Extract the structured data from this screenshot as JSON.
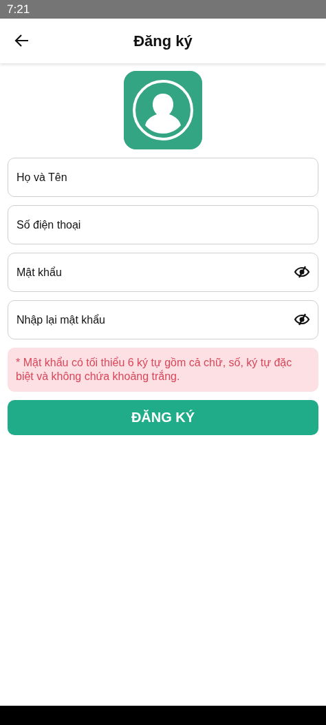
{
  "status_bar": {
    "time": "7:21"
  },
  "app_bar": {
    "title": "Đăng ký"
  },
  "fields": [
    {
      "kind": "text",
      "placeholder": "Họ và Tên"
    },
    {
      "kind": "text",
      "placeholder": "Số điện thoại"
    },
    {
      "kind": "password",
      "placeholder": "Mật khẩu"
    },
    {
      "kind": "password",
      "placeholder": "Nhập lại mật khẩu"
    }
  ],
  "notice": "* Mật khẩu có tối thiểu 6 ký tự gồm cả chữ, số, ký tự đặc biệt và không chứa khoảng trắng.",
  "submit_button": "ĐĂNG KÝ"
}
